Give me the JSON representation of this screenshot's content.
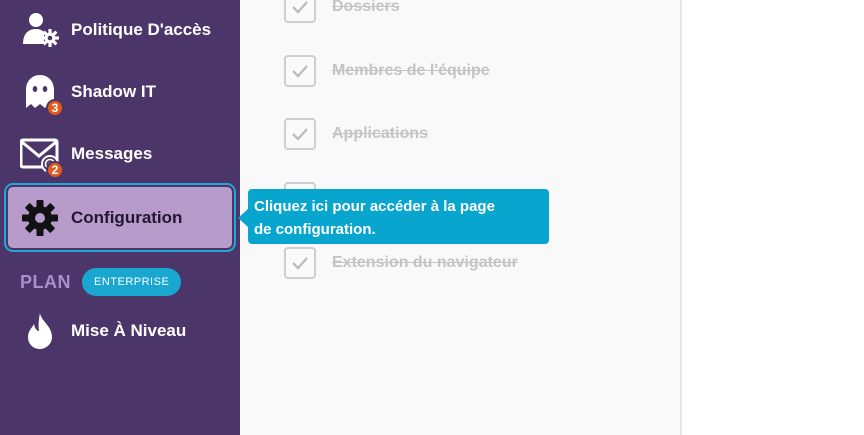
{
  "sidebar": {
    "items": [
      {
        "label": "Politique D'accès",
        "icon": "user-gear-icon"
      },
      {
        "label": "Shadow IT",
        "icon": "ghost-icon",
        "badge": "3"
      },
      {
        "label": "Messages",
        "icon": "envelope-icon",
        "badge": "2"
      },
      {
        "label": "Configuration",
        "icon": "gear-icon",
        "active": true
      },
      {
        "label": "Mise À Niveau",
        "icon": "flame-icon"
      }
    ],
    "plan": {
      "label": "PLAN",
      "badge": "ENTERPRISE"
    }
  },
  "tasks": [
    {
      "label": "Dossiers",
      "done": true
    },
    {
      "label": "Membres de l'équipe",
      "done": true
    },
    {
      "label": "Applications",
      "done": true
    },
    {
      "label": "",
      "done": false
    },
    {
      "label": "Extension du navigateur",
      "done": true
    }
  ],
  "tooltip": {
    "line1": "Cliquez ici pour accéder à la page",
    "line2": "de configuration."
  },
  "colors": {
    "sidebar": "#4b3569",
    "active_item": "#b79bcb",
    "accent": "#08a6cf",
    "badge": "#e35b1c"
  }
}
